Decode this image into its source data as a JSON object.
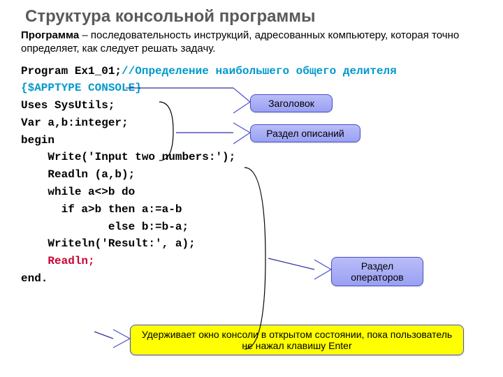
{
  "title": "Структура консольной программы",
  "definition": {
    "word": "Программа",
    "rest": " – последовательность инструкций, адресованных компьютеру, которая точно определяет, как следует решать задачу."
  },
  "code": {
    "l1a": "Program Ex1_01;",
    "l1b": "//Определение наибольшего общего делителя",
    "l2": "{$APPTYPE CONSOLE}",
    "l3": "Uses SysUtils;",
    "l4": "Var a,b:integer;",
    "l5": "begin",
    "l6": "    Write('Input two numbers:');",
    "l7": "    Readln (a,b);",
    "l8": "    while a<>b do",
    "l9": "      if a>b then a:=a-b",
    "l10": "             else b:=b-a;",
    "l11": "    Writeln('Result:', a);",
    "l12": "    Readln;",
    "l13": "end."
  },
  "callouts": {
    "header": "Заголовок",
    "declarations": "Раздел описаний",
    "operators": "Раздел операторов",
    "hold": "Удерживает окно консоли в открытом состоянии, пока пользователь не нажал клавишу Enter"
  }
}
